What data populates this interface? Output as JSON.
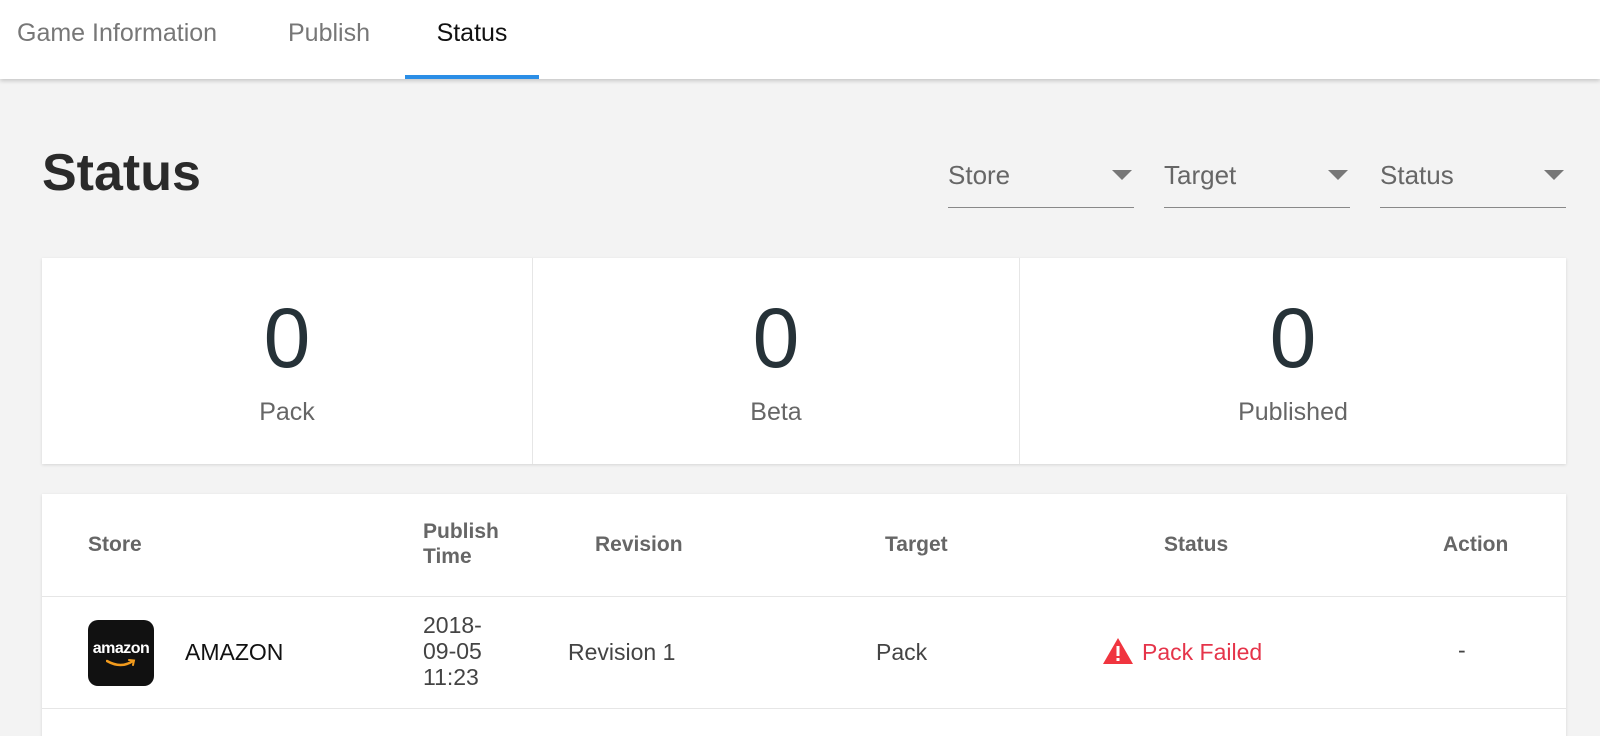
{
  "tabs": [
    {
      "label": "Game Information"
    },
    {
      "label": "Publish"
    },
    {
      "label": "Status",
      "active": true
    }
  ],
  "accent_color": "#2b8ee6",
  "page_title": "Status",
  "filters": {
    "store": "Store",
    "target": "Target",
    "status": "Status"
  },
  "stats": [
    {
      "value": "0",
      "label": "Pack"
    },
    {
      "value": "0",
      "label": "Beta"
    },
    {
      "value": "0",
      "label": "Published"
    }
  ],
  "table": {
    "columns": {
      "store": "Store",
      "publish_time": "Publish Time",
      "revision": "Revision",
      "target": "Target",
      "status": "Status",
      "action": "Action"
    },
    "rows": [
      {
        "logo_text": "amazon",
        "store": "AMAZON",
        "publish_time": "2018-09-05 11:23",
        "revision": "Revision 1",
        "target": "Pack",
        "status": "Pack Failed",
        "status_icon": "warning-icon",
        "status_color": "#e5344a",
        "action": "-"
      }
    ]
  }
}
